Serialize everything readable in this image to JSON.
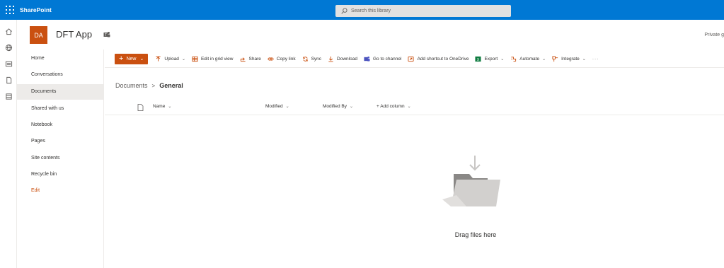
{
  "suite": {
    "brand": "SharePoint",
    "search_placeholder": "Search this library",
    "icons": [
      "waffle-icon",
      "search-icon"
    ],
    "color": "#0078d4"
  },
  "appbar": {
    "icons": [
      "home-icon",
      "globe-icon",
      "news-icon",
      "document-icon",
      "list-icon"
    ]
  },
  "site": {
    "logo_initials": "DA",
    "logo_color": "#ca5010",
    "title": "DFT App",
    "privacy": "Private g"
  },
  "nav": {
    "items": [
      {
        "label": "Home"
      },
      {
        "label": "Conversations"
      },
      {
        "label": "Documents",
        "active": true
      },
      {
        "label": "Shared with us"
      },
      {
        "label": "Notebook"
      },
      {
        "label": "Pages"
      },
      {
        "label": "Site contents"
      },
      {
        "label": "Recycle bin"
      },
      {
        "label": "Edit"
      }
    ]
  },
  "commands": {
    "new": "New",
    "upload": "Upload",
    "edit_grid": "Edit in grid view",
    "share": "Share",
    "copy_link": "Copy link",
    "sync": "Sync",
    "download": "Download",
    "go_to_channel": "Go to channel",
    "add_shortcut": "Add shortcut to OneDrive",
    "export": "Export",
    "automate": "Automate",
    "integrate": "Integrate",
    "more": "···"
  },
  "breadcrumb": {
    "root": "Documents",
    "separator": ">",
    "current": "General"
  },
  "columns": {
    "name": "Name",
    "modified": "Modified",
    "modified_by": "Modified By",
    "add_column": "+ Add column"
  },
  "empty": {
    "message": "Drag files here"
  }
}
